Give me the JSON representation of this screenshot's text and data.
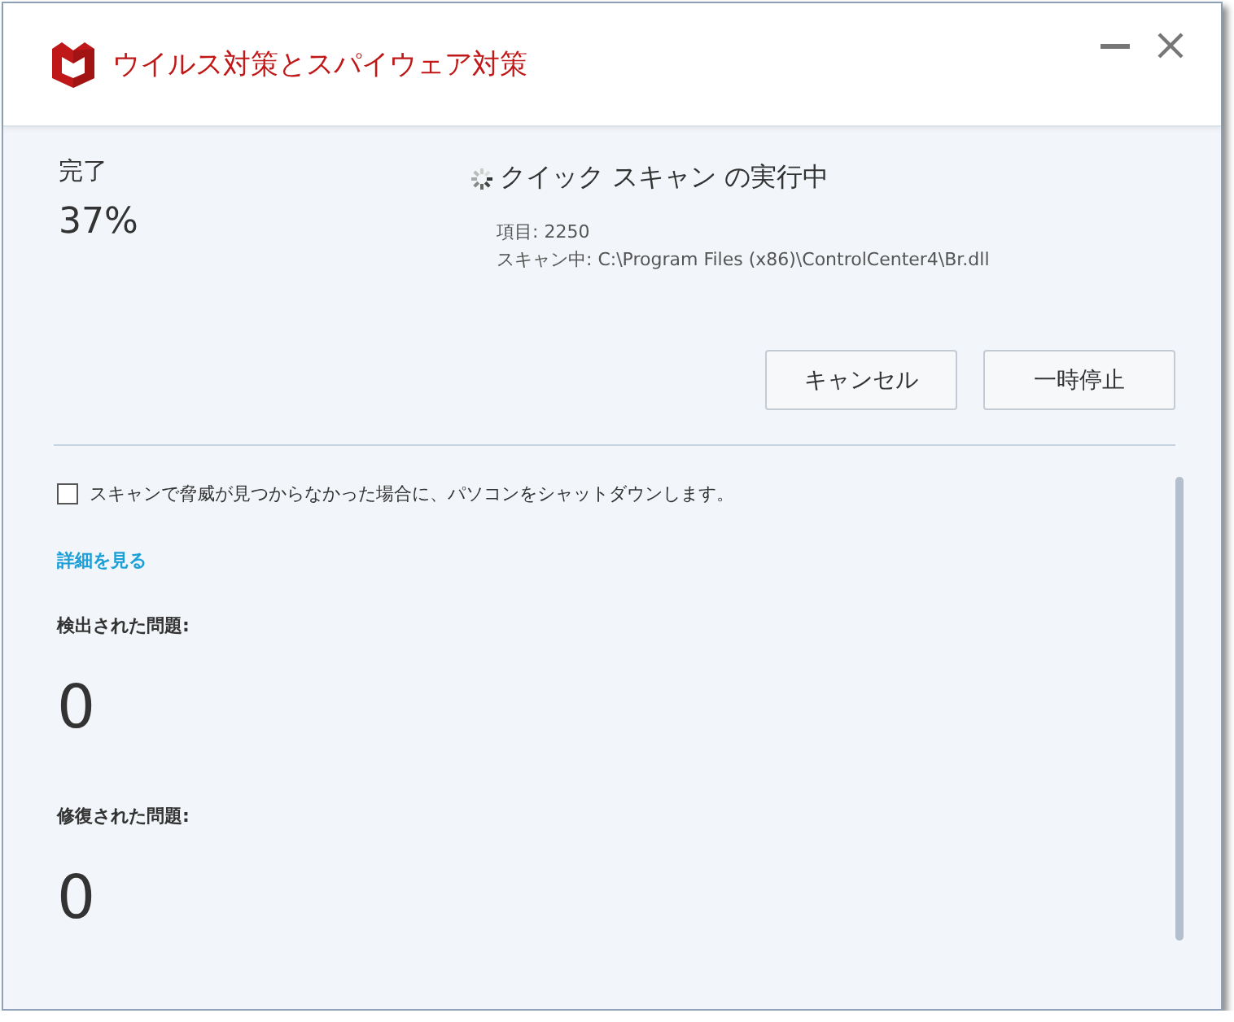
{
  "window": {
    "title": "ウイルス対策とスパイウェア対策",
    "controls": [
      {
        "kind": "minimize"
      },
      {
        "kind": "close"
      }
    ]
  },
  "progress": {
    "label": "完了",
    "percent": "37%"
  },
  "scan": {
    "title": "クイック スキャン の実行中",
    "details": [
      "項目: 2250",
      "スキャン中: C:\\Program Files (x86)\\ControlCenter4\\Br.dll"
    ]
  },
  "buttons": [
    "キャンセル",
    "一時停止"
  ],
  "shutdown_option": {
    "label": "スキャンで脅威が見つからなかった場合に、パソコンをシャットダウンします。",
    "checked": false
  },
  "details_link": "詳細を見る",
  "stats": [
    {
      "label": "検出された問題:",
      "value": "0"
    },
    {
      "label": "修復された問題:",
      "value": "0"
    }
  ]
}
